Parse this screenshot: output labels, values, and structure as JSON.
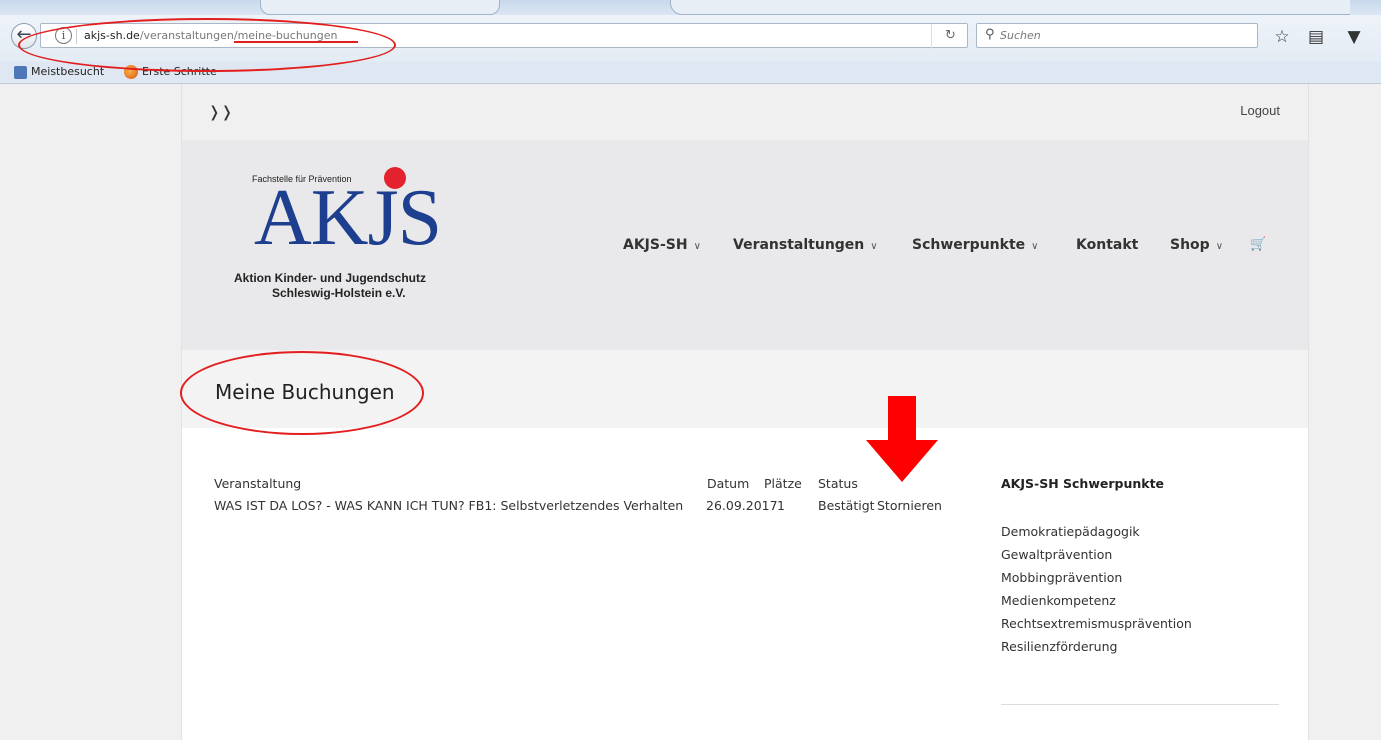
{
  "browser": {
    "url_host": "akjs-sh.de",
    "url_path": "/veranstaltungen/meine-buchungen",
    "search_placeholder": "Suchen",
    "bookmarks": [
      "Meistbesucht",
      "Erste Schritte"
    ]
  },
  "site": {
    "logout": "Logout",
    "logo": {
      "tagline": "Fachstelle für Prävention",
      "wordmark": "AKJS",
      "subtitle_line1": "Aktion Kinder- und Jugendschutz",
      "subtitle_line2": "Schleswig-Holstein e.V."
    },
    "nav": [
      {
        "label": "AKJS-SH",
        "dropdown": true
      },
      {
        "label": "Veranstaltungen",
        "dropdown": true
      },
      {
        "label": "Schwerpunkte",
        "dropdown": true
      },
      {
        "label": "Kontakt",
        "dropdown": false
      },
      {
        "label": "Shop",
        "dropdown": true
      }
    ],
    "page_title": "Meine Buchungen",
    "table": {
      "headers": [
        "Veranstaltung",
        "Datum",
        "Plätze",
        "Status"
      ],
      "rows": [
        {
          "veranstaltung": "WAS IST DA LOS? - WAS KANN ICH TUN? FB1: Selbstverletzendes Verhalten",
          "datum": "26.09.2017",
          "plaetze": "1",
          "status": "Bestätigt",
          "action": "Stornieren"
        }
      ]
    },
    "sidebar": {
      "title": "AKJS-SH Schwerpunkte",
      "items": [
        "Demokratiepädagogik",
        "Gewaltprävention",
        "Mobbingprävention",
        "Medienkompetenz",
        "Rechtsextremismusprävention",
        "Resilienzförderung"
      ]
    }
  },
  "colors": {
    "annotation_red": "#e31e1e",
    "logo_blue": "#1e3f8f",
    "logo_dot_red": "#e4222e"
  }
}
